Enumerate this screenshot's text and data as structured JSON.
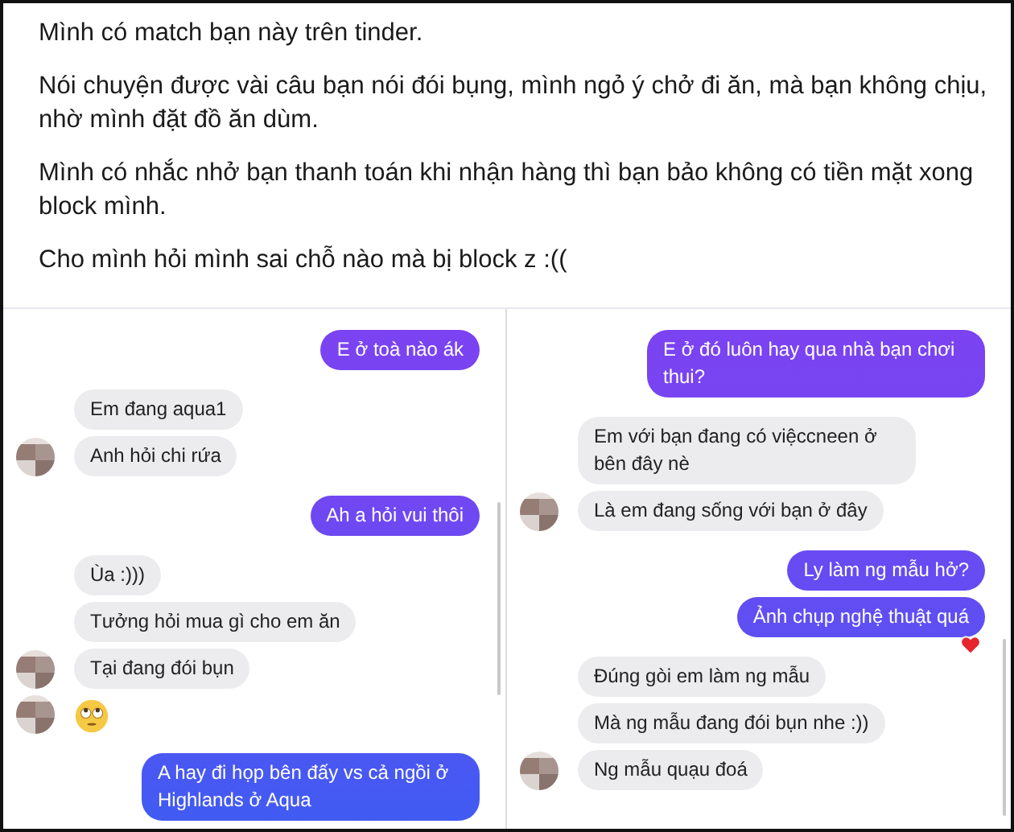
{
  "post": {
    "paragraphs": [
      "Mình có match bạn này trên tinder.",
      "Nói chuyện được vài câu bạn nói đói bụng, mình ngỏ ý chở đi ăn, mà bạn không chịu, nhờ mình đặt đồ ăn dùm.",
      "Mình có nhắc nhở bạn thanh toán khi nhận hàng thì bạn bảo không có tiền mặt xong block mình.",
      "Cho mình hỏi mình sai chỗ nào mà bị block z :(("
    ]
  },
  "chats": [
    {
      "messages": [
        {
          "kind": "text",
          "outgoing": true,
          "text": "E ở toà nào ák",
          "avatar": false
        },
        {
          "kind": "text",
          "outgoing": false,
          "text": "Em đang aqua1",
          "avatar": false
        },
        {
          "kind": "text",
          "outgoing": false,
          "text": "Anh hỏi chi rứa",
          "avatar": true
        },
        {
          "kind": "text",
          "outgoing": true,
          "text": "Ah a hỏi vui thôi",
          "avatar": false
        },
        {
          "kind": "text",
          "outgoing": false,
          "text": "Ùa :)))",
          "avatar": false
        },
        {
          "kind": "text",
          "outgoing": false,
          "text": "Tưởng hỏi mua gì cho em ăn",
          "avatar": false
        },
        {
          "kind": "text",
          "outgoing": false,
          "text": "Tại đang đói bụn",
          "avatar": true
        },
        {
          "kind": "emoji",
          "outgoing": false,
          "avatar": true
        },
        {
          "kind": "text",
          "outgoing": true,
          "text": "A hay đi họp bên đấy vs cả ngồi ở Highlands ở Aqua",
          "avatar": false
        }
      ]
    },
    {
      "messages": [
        {
          "kind": "text",
          "outgoing": true,
          "text": "E ở đó luôn hay qua nhà bạn chơi thui?",
          "avatar": false
        },
        {
          "kind": "text",
          "outgoing": false,
          "text": "Em với bạn đang có việccneen ở bên đây nè",
          "avatar": false
        },
        {
          "kind": "text",
          "outgoing": false,
          "text": "Là em đang sống với bạn ở đây",
          "avatar": true
        },
        {
          "kind": "text",
          "outgoing": true,
          "text": "Ly làm ng mẫu hở?",
          "avatar": false
        },
        {
          "kind": "text",
          "outgoing": true,
          "text": "Ảnh chụp nghệ thuật quá",
          "avatar": false,
          "reaction": true
        },
        {
          "kind": "text",
          "outgoing": false,
          "text": "Đúng gòi em làm ng mẫu",
          "avatar": false
        },
        {
          "kind": "text",
          "outgoing": false,
          "text": "Mà ng mẫu đang đói bụn nhe :))",
          "avatar": false
        },
        {
          "kind": "text",
          "outgoing": false,
          "text": "Ng mẫu quạu đoá",
          "avatar": true
        }
      ]
    }
  ]
}
